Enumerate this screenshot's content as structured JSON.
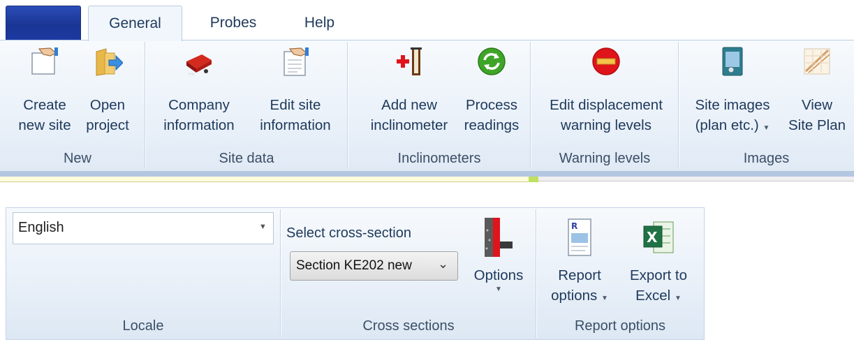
{
  "tabs": [
    {
      "label": "General",
      "active": true
    },
    {
      "label": "Probes",
      "active": false
    },
    {
      "label": "Help",
      "active": false
    }
  ],
  "ribbon_top": {
    "groups": [
      {
        "label": "New",
        "buttons": [
          {
            "line1": "Create",
            "line2": "new site",
            "icon": "new-site-hand-icon"
          },
          {
            "line1": "Open",
            "line2": "project",
            "icon": "open-folder-icon"
          }
        ]
      },
      {
        "label": "Site data",
        "buttons": [
          {
            "line1": "Company",
            "line2": "information",
            "icon": "company-building-icon"
          },
          {
            "line1": "Edit site",
            "line2": "information",
            "icon": "edit-document-hand-icon"
          }
        ]
      },
      {
        "label": "Inclinometers",
        "buttons": [
          {
            "line1": "Add new",
            "line2": "inclinometer",
            "icon": "add-inclinometer-icon"
          },
          {
            "line1": "Process",
            "line2": "readings",
            "icon": "process-refresh-icon"
          }
        ]
      },
      {
        "label": "Warning levels",
        "buttons": [
          {
            "line1": "Edit displacement",
            "line2": "warning levels",
            "icon": "warning-stop-icon"
          }
        ]
      },
      {
        "label": "Images",
        "buttons": [
          {
            "line1": "Site images",
            "line2": "(plan etc.)",
            "icon": "site-images-icon",
            "dropdown": true
          },
          {
            "line1": "View",
            "line2": "Site Plan",
            "icon": "site-plan-icon"
          }
        ]
      }
    ]
  },
  "ribbon_bottom": {
    "locale": {
      "label": "Locale",
      "selected": "English"
    },
    "cross_sections": {
      "label": "Cross sections",
      "select_label": "Select cross-section",
      "selected": "Section KE202 new",
      "options_label": "Options",
      "options_icon": "cross-section-options-icon"
    },
    "report": {
      "label": "Report options",
      "buttons": [
        {
          "line1": "Report",
          "line2": "options",
          "icon": "report-document-icon",
          "dropdown": true
        },
        {
          "line1": "Export to",
          "line2": "Excel",
          "icon": "excel-icon",
          "dropdown": true
        }
      ]
    }
  },
  "colors": {
    "ribbon_text": "#1e395b",
    "app_button": "#1c3aa3",
    "warning_red": "#e0141b",
    "refresh_green": "#3fa528"
  }
}
